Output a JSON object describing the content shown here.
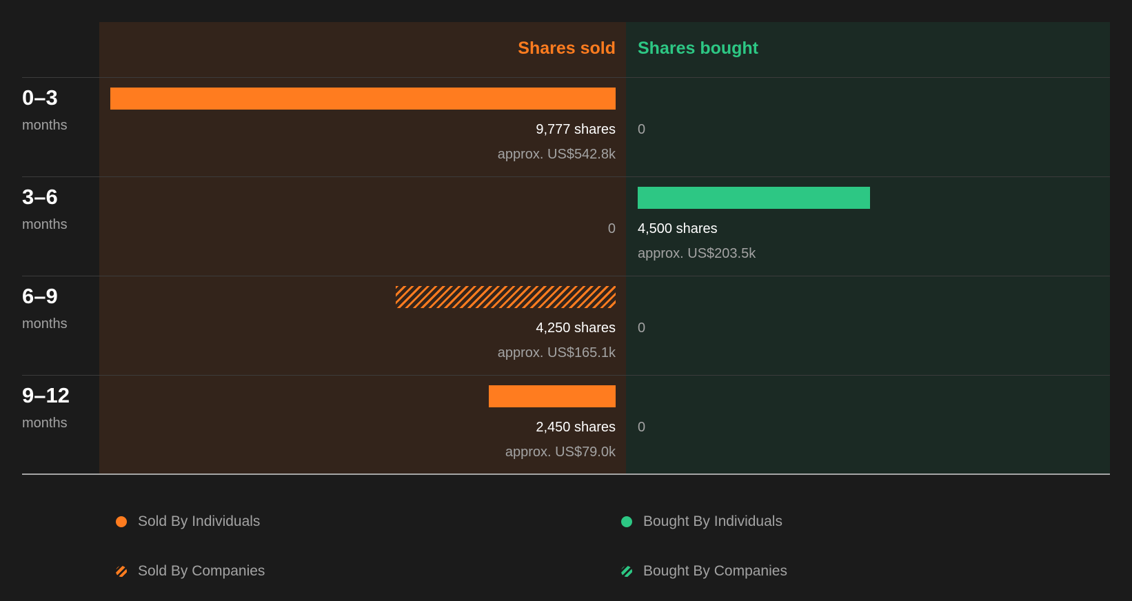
{
  "chart_data": {
    "type": "bar",
    "headers": {
      "sold": "Shares sold",
      "bought": "Shares bought"
    },
    "rows": [
      {
        "range": "0–3",
        "unit": "months",
        "sold": 9777,
        "sold_label": "9,777 shares",
        "sold_value": "approx. US$542.8k",
        "sold_by": "individuals",
        "bought": 0,
        "bought_label": "0",
        "bought_value": "",
        "bought_by": "individuals"
      },
      {
        "range": "3–6",
        "unit": "months",
        "sold": 0,
        "sold_label": "0",
        "sold_value": "",
        "sold_by": "individuals",
        "bought": 4500,
        "bought_label": "4,500 shares",
        "bought_value": "approx. US$203.5k",
        "bought_by": "individuals"
      },
      {
        "range": "6–9",
        "unit": "months",
        "sold": 4250,
        "sold_label": "4,250 shares",
        "sold_value": "approx. US$165.1k",
        "sold_by": "companies",
        "bought": 0,
        "bought_label": "0",
        "bought_value": "",
        "bought_by": "individuals"
      },
      {
        "range": "9–12",
        "unit": "months",
        "sold": 2450,
        "sold_label": "2,450 shares",
        "sold_value": "approx. US$79.0k",
        "sold_by": "individuals",
        "bought": 0,
        "bought_label": "0",
        "bought_value": "",
        "bought_by": "individuals"
      }
    ],
    "max_shares": 9777,
    "legend": [
      {
        "label": "Sold By Individuals",
        "style": "solid-sold"
      },
      {
        "label": "Bought By Individuals",
        "style": "solid-bought"
      },
      {
        "label": "Sold By Companies",
        "style": "hatch-sold"
      },
      {
        "label": "Bought By Companies",
        "style": "hatch-bought"
      }
    ],
    "colors": {
      "sold": "#ff7c1f",
      "bought": "#2dc784",
      "sold_panel": "#33241b",
      "bought_panel": "#1b2a24",
      "background": "#1b1b1b"
    }
  }
}
